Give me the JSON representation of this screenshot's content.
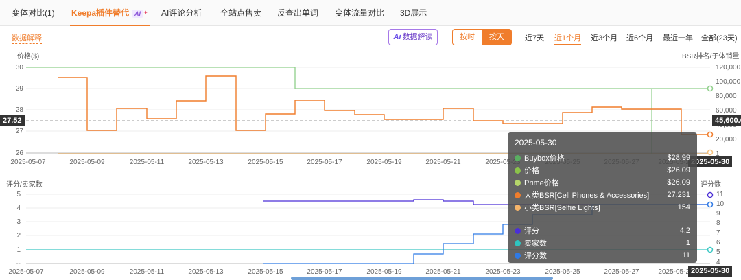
{
  "tabs": [
    {
      "label": "变体对比(1)"
    },
    {
      "label": "Keepa插件替代",
      "tag": "AI"
    },
    {
      "label": "AI评论分析"
    },
    {
      "label": "全站点售卖"
    },
    {
      "label": "反查出单词"
    },
    {
      "label": "变体流量对比"
    },
    {
      "label": "3D展示"
    }
  ],
  "toolbar": {
    "data_explain": "数据解释",
    "ai_btn": "数据解读",
    "ai_logo": "Ai",
    "by_hour": "按时",
    "by_day": "按天",
    "ranges": [
      "近7天",
      "近1个月",
      "近3个月",
      "近6个月",
      "最近一年",
      "全部(23天)"
    ],
    "active_range": "近1个月"
  },
  "top_chart": {
    "left_title": "价格($)",
    "right_title": "BSR排名/子体销量",
    "left_ticks": [
      "30",
      "29",
      "28",
      "27",
      "26"
    ],
    "right_ticks": [
      "120,000",
      "100,000",
      "80,000",
      "60,000",
      "40,000",
      "20,000",
      "1"
    ],
    "crosshair_left": "27.52",
    "crosshair_right": "45,600.6",
    "x_ticks": [
      "2025-05-07",
      "2025-05-09",
      "2025-05-11",
      "2025-05-13",
      "2025-05-15",
      "2025-05-17",
      "2025-05-19",
      "2025-05-21",
      "2025-05-23",
      "2025-05-25",
      "2025-05-27",
      "2025-05-29"
    ],
    "x_badge": "2025-05-30"
  },
  "bottom_chart": {
    "left_title": "评分/卖家数",
    "right_title": "评分数",
    "left_ticks": [
      "5",
      "4",
      "3",
      "2",
      "1",
      "--"
    ],
    "right_ticks": [
      "11",
      "10",
      "9",
      "8",
      "7",
      "6",
      "5",
      "4"
    ],
    "x_ticks": [
      "2025-05-07",
      "2025-05-09",
      "2025-05-11",
      "2025-05-13",
      "2025-05-15",
      "2025-05-17",
      "2025-05-19",
      "2025-05-21",
      "2025-05-23",
      "2025-05-25",
      "2025-05-27",
      "2025-05-29"
    ],
    "x_badge": "2025-05-30"
  },
  "tooltip": {
    "date": "2025-05-30",
    "rows": [
      {
        "name": "Buybox价格",
        "value": "$28.99",
        "color": "#5aae61"
      },
      {
        "name": "价格",
        "value": "$26.09",
        "color": "#8bc34a"
      },
      {
        "name": "Prime价格",
        "value": "$26.09",
        "color": "#b5d66a"
      },
      {
        "name": "大类BSR[Cell Phones & Accessories]",
        "value": "27,231",
        "color": "#f07d2c"
      },
      {
        "name": "小类BSR[Selfie Lights]",
        "value": "154",
        "color": "#f5b46a"
      }
    ],
    "rows2": [
      {
        "name": "评分",
        "value": "4.2",
        "color": "#4b2fd6"
      },
      {
        "name": "卖家数",
        "value": "1",
        "color": "#2ec4c0"
      },
      {
        "name": "评分数",
        "value": "11",
        "color": "#2f7ae5"
      }
    ]
  },
  "colors": {
    "accent": "#f07d2c",
    "buybox": "#8fcf8a",
    "bsr": "#f07d2c",
    "small_bsr": "#f5c07a",
    "rating": "#4b2fd6",
    "sellers": "#3cc8c4",
    "reviews": "#2f7ae5"
  }
}
